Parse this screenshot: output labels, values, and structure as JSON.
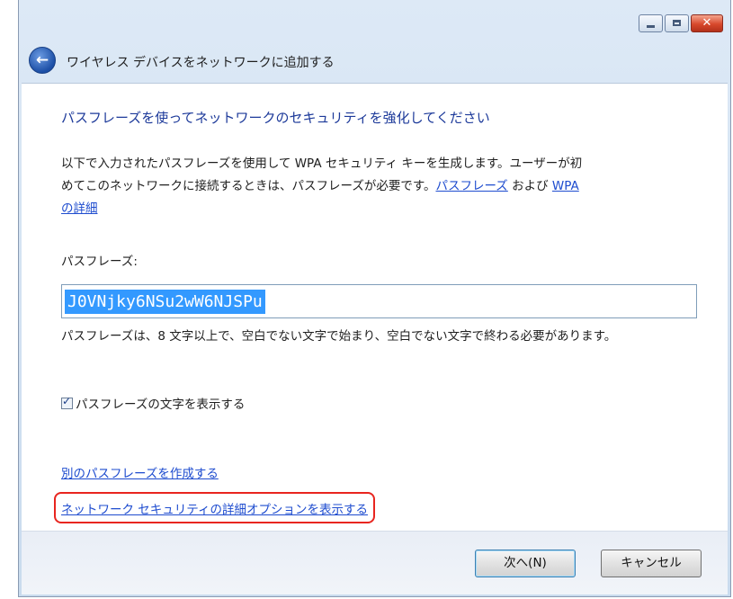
{
  "window": {
    "title": "ワイヤレス デバイスをネットワークに追加する"
  },
  "content": {
    "heading": "パスフレーズを使ってネットワークのセキュリティを強化してください",
    "para_line1": "以下で入力されたパスフレーズを使用して WPA セキュリティ キーを生成します。ユーザーが初",
    "para_line2_prefix": "めてこのネットワークに接続するときは、パスフレーズが必要です。",
    "link_passphrase": "パスフレーズ",
    "para_and": " および ",
    "link_wpa_part1": "WPA",
    "link_wpa_part2": "の詳細",
    "passphrase_label": "パスフレーズ:",
    "passphrase_value": "J0VNjky6NSu2wW6NJSPu",
    "hint": "パスフレーズは、8 文字以上で、空白でない文字で始まり、空白でない文字で終わる必要があります。",
    "show_chars_label": "パスフレーズの文字を表示する",
    "show_chars_checked": true,
    "create_other_link": "別のパスフレーズを作成する",
    "advanced_link": "ネットワーク セキュリティの詳細オプションを表示する"
  },
  "footer": {
    "next_label": "次へ(N)",
    "cancel_label": "キャンセル"
  },
  "colors": {
    "link": "#1e4ccf",
    "heading": "#1d3a9a",
    "highlight": "#e8251f",
    "selection": "#3399ff"
  }
}
